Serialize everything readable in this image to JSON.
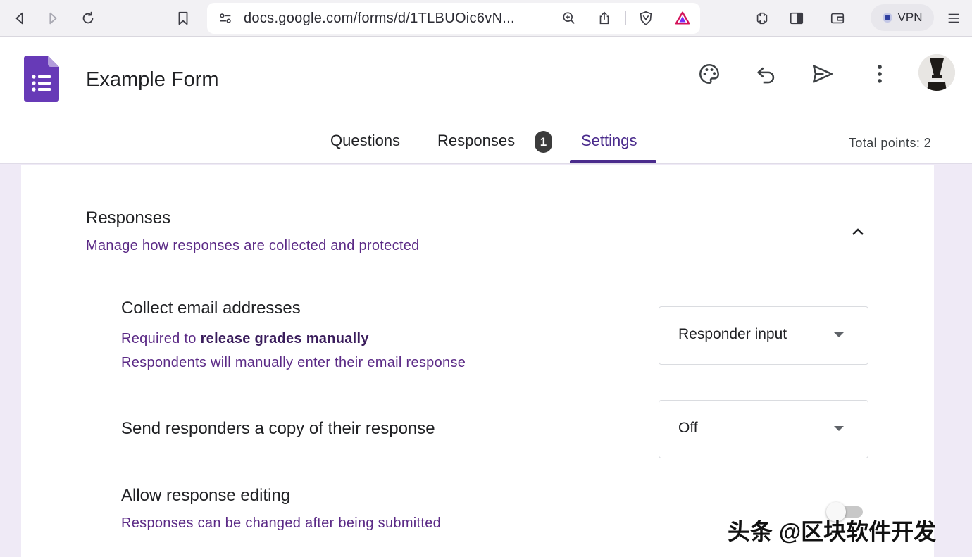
{
  "browser": {
    "url": "docs.google.com/forms/d/1TLBUOic6vN...",
    "vpn_label": "VPN"
  },
  "header": {
    "form_title": "Example Form",
    "tabs": [
      {
        "label": "Questions"
      },
      {
        "label": "Responses",
        "badge": "1"
      },
      {
        "label": "Settings",
        "active": true
      }
    ],
    "total_points": "Total points: 2"
  },
  "responses_section": {
    "title": "Responses",
    "subtitle": "Manage how responses are collected and protected",
    "settings": {
      "collect_email": {
        "title": "Collect email addresses",
        "desc_prefix": "Required to ",
        "desc_bold": "release grades manually",
        "desc_line2": "Respondents will manually enter their email response",
        "selected": "Responder input"
      },
      "send_copy": {
        "title": "Send responders a copy of their response",
        "selected": "Off"
      },
      "response_editing": {
        "title": "Allow response editing",
        "desc": "Responses can be changed after being submitted",
        "enabled": false
      }
    }
  },
  "watermark": "头条 @区块软件开发",
  "colors": {
    "accent_purple": "#4a2b8c",
    "description_purple": "#5b2a86",
    "background_lavender": "#efeaf6",
    "forms_logo": "#673ab7"
  }
}
